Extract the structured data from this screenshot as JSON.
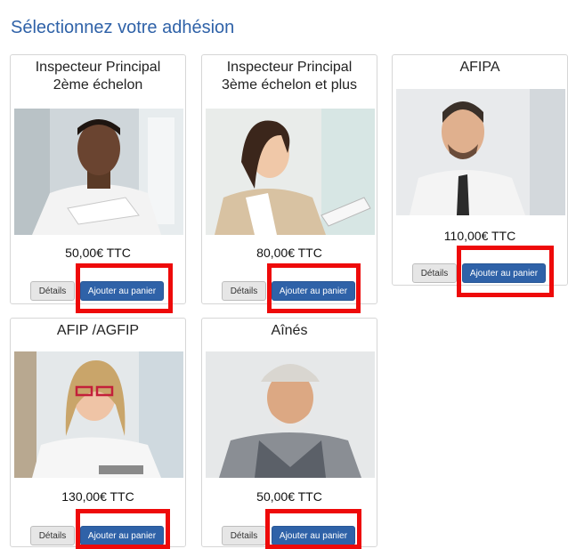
{
  "page": {
    "title": "Sélectionnez votre adhésion"
  },
  "products": [
    {
      "title": "Inspecteur Principal 2ème échelon",
      "price": "50,00€ TTC",
      "details_label": "Détails",
      "cart_label": "Ajouter au panier"
    },
    {
      "title": "Inspecteur Principal 3ème échelon et plus",
      "price": "80,00€ TTC",
      "details_label": "Détails",
      "cart_label": "Ajouter au panier"
    },
    {
      "title": "AFIPA",
      "price": "110,00€ TTC",
      "details_label": "Détails",
      "cart_label": "Ajouter au panier"
    },
    {
      "title": "AFIP /AGFIP",
      "price": "130,00€ TTC",
      "details_label": "Détails",
      "cart_label": "Ajouter au panier"
    },
    {
      "title": "Aînés",
      "price": "50,00€ TTC",
      "details_label": "Détails",
      "cart_label": "Ajouter au panier"
    }
  ],
  "colors": {
    "accent": "#2f62a8",
    "highlight": "#ee0a0a"
  }
}
